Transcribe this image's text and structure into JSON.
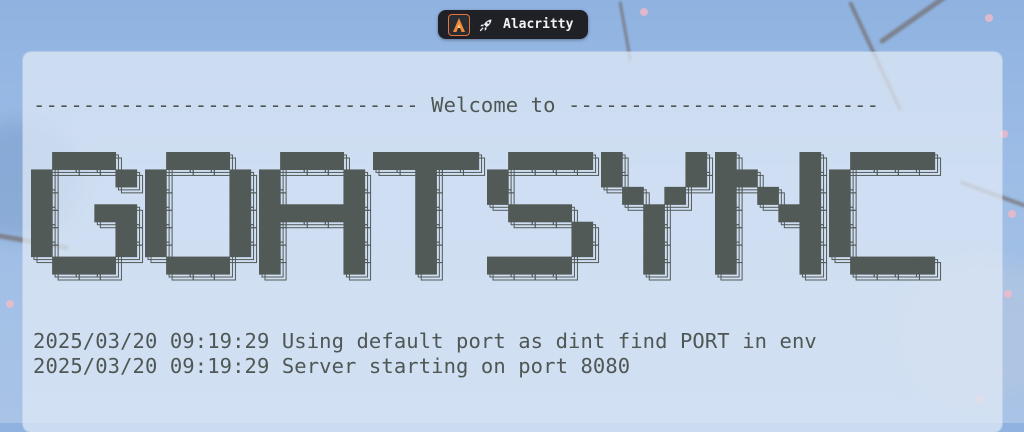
{
  "taskbar": {
    "app_icon": "alacritty-icon",
    "emoji_icon": "rocket-icon",
    "title": "Alacritty"
  },
  "terminal": {
    "welcome_line": "------------------------------- Welcome to -------------------------",
    "banner_text": "GOATSYNC",
    "log_lines": [
      "2025/03/20 09:19:29 Using default port as dint find PORT in env",
      "2025/03/20 09:19:29 Server starting on port 8080"
    ]
  },
  "colors": {
    "terminal_text": "#525a58",
    "terminal_bg": "#dfe8f5",
    "taskbar_bg": "#1f2126",
    "accent": "#e8743a"
  }
}
